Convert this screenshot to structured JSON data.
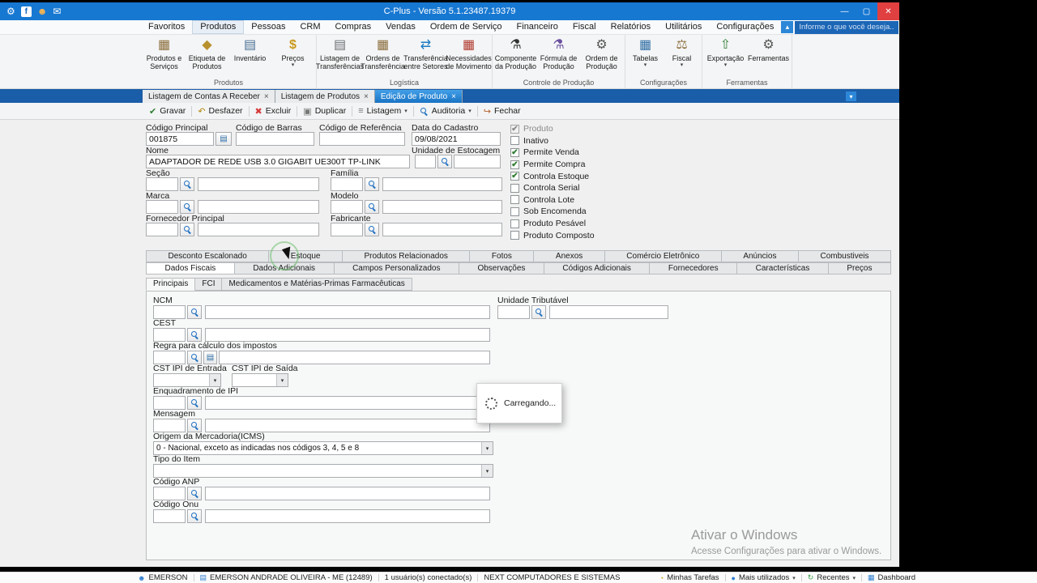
{
  "icons": {
    "gear": "⚙",
    "facebook_f": "f",
    "user": "☻",
    "chat": "✉",
    "minimize": "—",
    "maximize": "▢",
    "close": "✕",
    "chevron_up": "▴",
    "dropdown": "▾",
    "close_tab": "×",
    "box": "▦",
    "tag": "◆",
    "clipboard": "▤",
    "dollar": "$",
    "doc": "▤",
    "transfer": "⇄",
    "calendar": "▦",
    "flask": "⚗",
    "scales": "⚖",
    "export": "⇧",
    "check": "✔",
    "undo": "↶",
    "delete": "✖",
    "copy": "▣",
    "list": "≡",
    "exit": "↪",
    "card": "▤",
    "person": "☻",
    "building": "▤",
    "clock": "◔",
    "dot": "●",
    "refresh": "↻",
    "grid": "▦"
  },
  "colors": {
    "titlebar": "#1778d2",
    "tabstrip": "#1a5da8",
    "active_tab": "#1873c4",
    "check_green": "#2f7d32"
  },
  "window": {
    "title": "C-Plus - Versão 5.1.23487.19379"
  },
  "menu": {
    "tabs": [
      "Favoritos",
      "Produtos",
      "Pessoas",
      "CRM",
      "Compras",
      "Vendas",
      "Ordem de Serviço",
      "Financeiro",
      "Fiscal",
      "Relatórios",
      "Utilitários",
      "Configurações"
    ],
    "search_placeholder": "Informe o que você deseja..."
  },
  "ribbon": {
    "groups": [
      {
        "label": "Produtos",
        "buttons": [
          {
            "label": "Produtos e Serviços"
          },
          {
            "label": "Etiqueta de Produtos"
          },
          {
            "label": "Inventário"
          },
          {
            "label": "Preços"
          }
        ]
      },
      {
        "label": "Logística",
        "buttons": [
          {
            "label": "Listagem de Transferências"
          },
          {
            "label": "Ordens de Transferência"
          },
          {
            "label": "Transferência entre Setores"
          },
          {
            "label": "Necessidades de Movimento"
          }
        ]
      },
      {
        "label": "Controle de Produção",
        "buttons": [
          {
            "label": "Componente da Produção"
          },
          {
            "label": "Fórmula de Produção"
          },
          {
            "label": "Ordem de Produção"
          }
        ]
      },
      {
        "label": "Configurações",
        "buttons": [
          {
            "label": "Tabelas"
          },
          {
            "label": "Fiscal"
          }
        ]
      },
      {
        "label": "Ferramentas",
        "buttons": [
          {
            "label": "Exportação"
          },
          {
            "label": "Ferramentas"
          }
        ]
      }
    ]
  },
  "doc_tabs": {
    "items": [
      {
        "label": "Listagem de Contas A Receber"
      },
      {
        "label": "Listagem de Produtos"
      },
      {
        "label": "Edição de Produto"
      }
    ]
  },
  "toolbar": {
    "buttons": [
      {
        "label": "Gravar"
      },
      {
        "label": "Desfazer"
      },
      {
        "label": "Excluir"
      },
      {
        "label": "Duplicar"
      },
      {
        "label": "Listagem"
      },
      {
        "label": "Auditoria"
      },
      {
        "label": "Fechar"
      }
    ]
  },
  "header_form": {
    "codigo_principal": {
      "label": "Código Principal",
      "value": "001875"
    },
    "codigo_barras": {
      "label": "Código de Barras",
      "value": ""
    },
    "codigo_referencia": {
      "label": "Código de Referência",
      "value": ""
    },
    "data_cadastro": {
      "label": "Data do Cadastro",
      "value": "09/08/2021"
    },
    "nome": {
      "label": "Nome",
      "value": "ADAPTADOR DE REDE USB 3.0 GIGABIT UE300T TP-LINK"
    },
    "unidade_estocagem": {
      "label": "Unidade de Estocagem",
      "value": ""
    },
    "secao": {
      "label": "Seção"
    },
    "familia": {
      "label": "Família"
    },
    "marca": {
      "label": "Marca"
    },
    "modelo": {
      "label": "Modelo"
    },
    "fornecedor_principal": {
      "label": "Fornecedor Principal"
    },
    "fabricante": {
      "label": "Fabricante"
    }
  },
  "flags": {
    "items": [
      {
        "label": "Produto",
        "checked": true,
        "disabled": true
      },
      {
        "label": "Inativo",
        "checked": false
      },
      {
        "label": "Permite Venda",
        "checked": true
      },
      {
        "label": "Permite Compra",
        "checked": true
      },
      {
        "label": "Controla Estoque",
        "checked": true
      },
      {
        "label": "Controla Serial",
        "checked": false
      },
      {
        "label": "Controla Lote",
        "checked": false
      },
      {
        "label": "Sob Encomenda",
        "checked": false
      },
      {
        "label": "Produto Pesável",
        "checked": false
      },
      {
        "label": "Produto Composto",
        "checked": false
      }
    ]
  },
  "tabs_row1": {
    "items": [
      "Desconto Escalonado",
      "Estoque",
      "Produtos Relacionados",
      "Fotos",
      "Anexos",
      "Comércio Eletrônico",
      "Anúncios",
      "Combustiveis"
    ]
  },
  "tabs_row2": {
    "items": [
      "Dados Fiscais",
      "Dados Adicionais",
      "Campos Personalizados",
      "Observações",
      "Códigos Adicionais",
      "Fornecedores",
      "Características",
      "Preços"
    ]
  },
  "inner_tabs": {
    "items": [
      "Principais",
      "FCI",
      "Medicamentos e Matérias-Primas Farmacêuticas"
    ]
  },
  "fiscal": {
    "ncm": {
      "label": "NCM"
    },
    "unidade_tributavel": {
      "label": "Unidade Tributável"
    },
    "cest": {
      "label": "CEST"
    },
    "regra": {
      "label": "Regra para cálculo dos impostos"
    },
    "cst_ipi_entrada": {
      "label": "CST IPI de Entrada"
    },
    "cst_ipi_saida": {
      "label": "CST IPI de Saída"
    },
    "enquadramento_ipi": {
      "label": "Enquadramento de IPI"
    },
    "mensagem": {
      "label": "Mensagem"
    },
    "origem": {
      "label": "Origem da Mercadoria(ICMS)",
      "value": "0 - Nacional, exceto as indicadas nos códigos 3, 4, 5 e 8"
    },
    "tipo_item": {
      "label": "Tipo do Item"
    },
    "codigo_anp": {
      "label": "Código ANP"
    },
    "codigo_onu": {
      "label": "Código Onu"
    }
  },
  "loading": {
    "text": "Carregando..."
  },
  "watermark": {
    "line1": "Ativar o Windows",
    "line2": "Acesse Configurações para ativar o Windows."
  },
  "statusbar": {
    "left": [
      "EMERSON",
      "EMERSON ANDRADE OLIVEIRA - ME (12489)",
      "1 usuário(s) conectado(s)",
      "NEXT COMPUTADORES E SISTEMAS"
    ],
    "right": [
      "Minhas Tarefas",
      "Mais utilizados",
      "Recentes",
      "Dashboard"
    ]
  }
}
